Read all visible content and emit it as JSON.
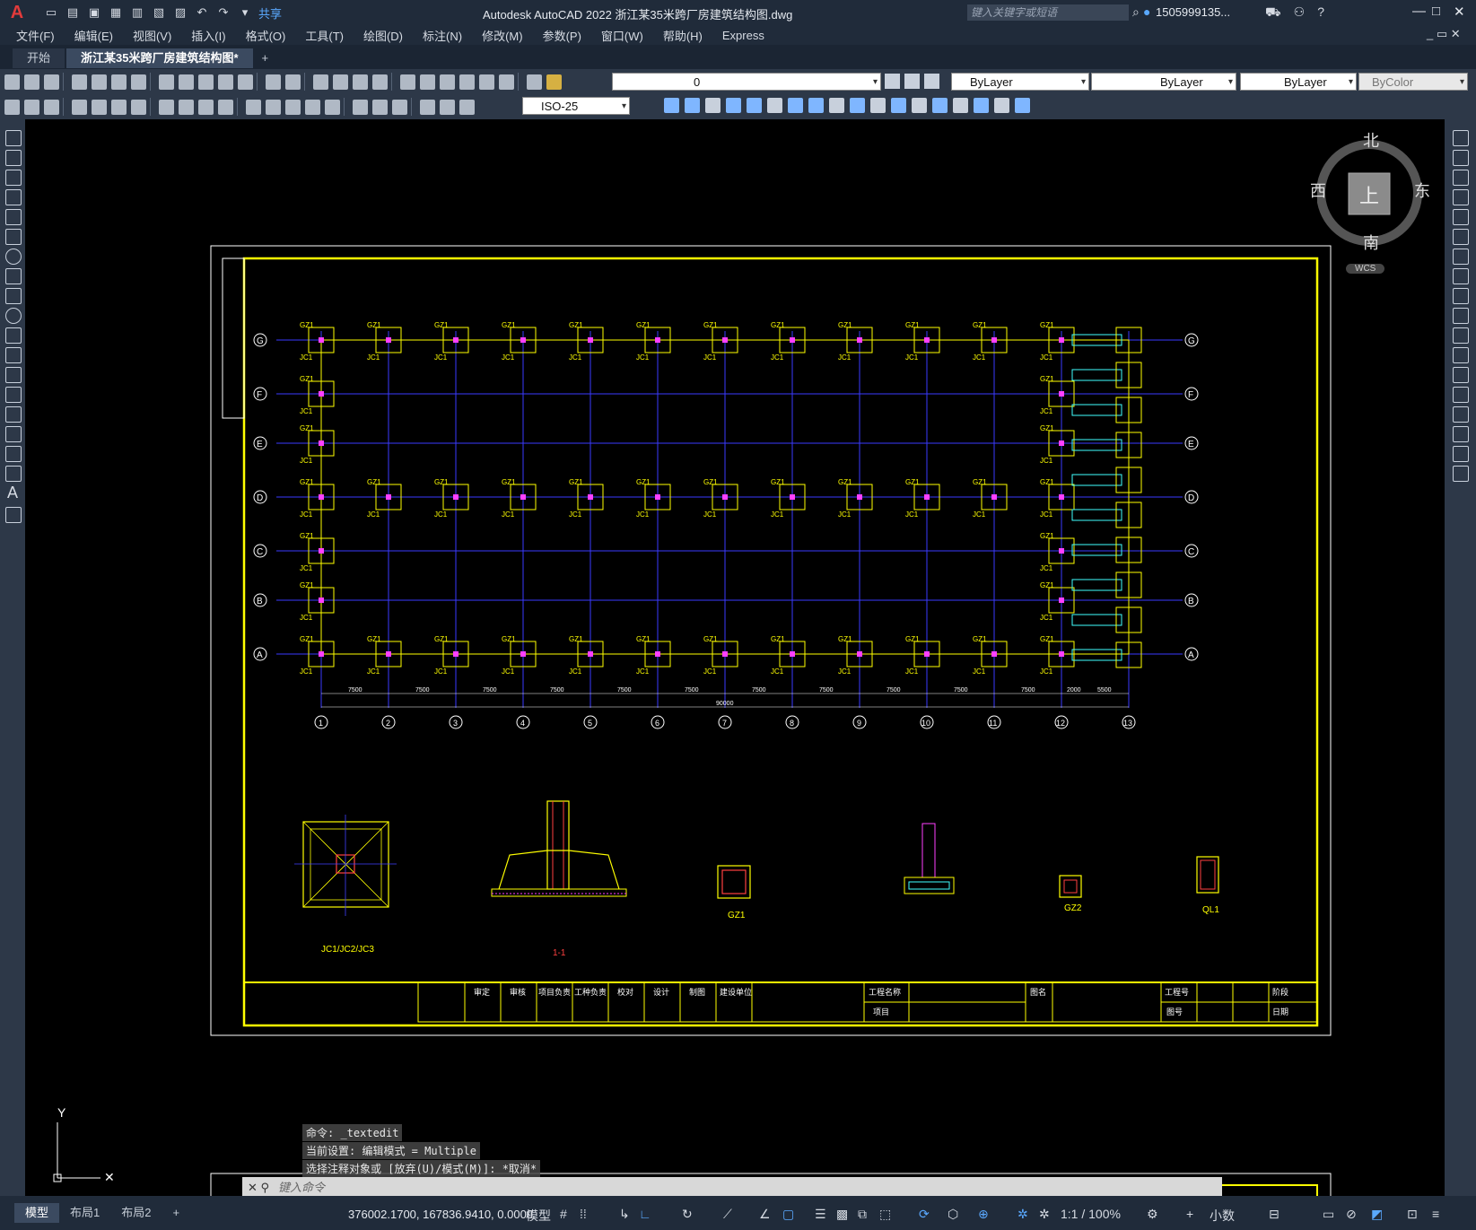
{
  "app": {
    "title": "Autodesk AutoCAD 2022    浙江某35米跨厂房建筑结构图.dwg",
    "share_label": "共享",
    "search_placeholder": "键入关键字或短语",
    "user": "1505999135...",
    "logo": "A"
  },
  "menu": [
    "文件(F)",
    "编辑(E)",
    "视图(V)",
    "插入(I)",
    "格式(O)",
    "工具(T)",
    "绘图(D)",
    "标注(N)",
    "修改(M)",
    "参数(P)",
    "窗口(W)",
    "帮助(H)",
    "Express"
  ],
  "tabs": [
    "开始",
    "浙江某35米跨厂房建筑结构图*",
    "+"
  ],
  "toolbar": {
    "layer_value": "0",
    "color_value": "ByLayer",
    "linetype_value": "ByLayer",
    "lineweight_value": "ByLayer",
    "plotstyle_value": "ByColor",
    "dimstyle_value": "ISO-25"
  },
  "navcube": {
    "north": "北",
    "south": "南",
    "east": "东",
    "west": "西",
    "top": "上",
    "wcs": "WCS"
  },
  "drawing": {
    "grid_rows": [
      "G",
      "F",
      "E",
      "D",
      "C",
      "B",
      "A"
    ],
    "grid_cols": [
      "1",
      "2",
      "3",
      "4",
      "5",
      "6",
      "7",
      "8",
      "9",
      "10",
      "11",
      "12",
      "13"
    ],
    "column_label": "GZ1",
    "base_label": "JC1",
    "dim_spacing": "7500",
    "dim_total": "90000",
    "dim_right_a": "2000",
    "dim_right_b": "5500",
    "detail_labels": [
      "JC1/JC2/JC3",
      "1-1",
      "GZ1",
      "GZ2",
      "QL1"
    ],
    "title_block": [
      "审定",
      "审核",
      "项目负责",
      "工种负责",
      "校对",
      "设计",
      "制图",
      "建设单位",
      "工程名称",
      "项目",
      "图名",
      "工程号",
      "图号",
      "阶段",
      "日期"
    ]
  },
  "command": {
    "history": [
      "命令: _textedit",
      "当前设置: 编辑模式 = Multiple",
      "选择注释对象或 [放弃(U)/模式(M)]: *取消*"
    ],
    "placeholder": "键入命令"
  },
  "status": {
    "tabs": [
      "模型",
      "布局1",
      "布局2",
      "+"
    ],
    "coords": "376002.1700, 167836.9410, 0.0000",
    "space": "模型",
    "scale": "1:1 / 100%",
    "units": "小数"
  }
}
